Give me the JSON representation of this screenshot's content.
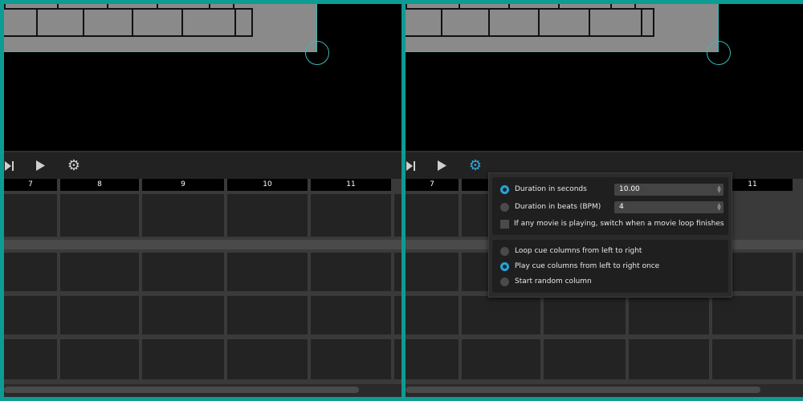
{
  "toolbar": {
    "skip_icon": "skip-to-end-icon",
    "play_icon": "play-icon",
    "settings_icon": "gear-icon"
  },
  "columns": {
    "left": [
      "7",
      "8",
      "9",
      "10",
      "11"
    ],
    "right": [
      "7",
      "11"
    ]
  },
  "popup": {
    "duration_seconds_label": "Duration in seconds",
    "duration_seconds_value": "10.00",
    "duration_beats_label": "Duration in beats (BPM)",
    "duration_beats_value": "4",
    "switch_on_loop_label": "If any movie is playing, switch when a movie loop finishes",
    "loop_columns_label": "Loop cue columns from left to right",
    "play_once_label": "Play cue columns from left to right once",
    "random_column_label": "Start random column",
    "selected_duration_mode": "seconds",
    "selected_play_mode": "play_once"
  },
  "colors": {
    "frame_border": "#0e9b93",
    "accent": "#2aa2d5"
  }
}
